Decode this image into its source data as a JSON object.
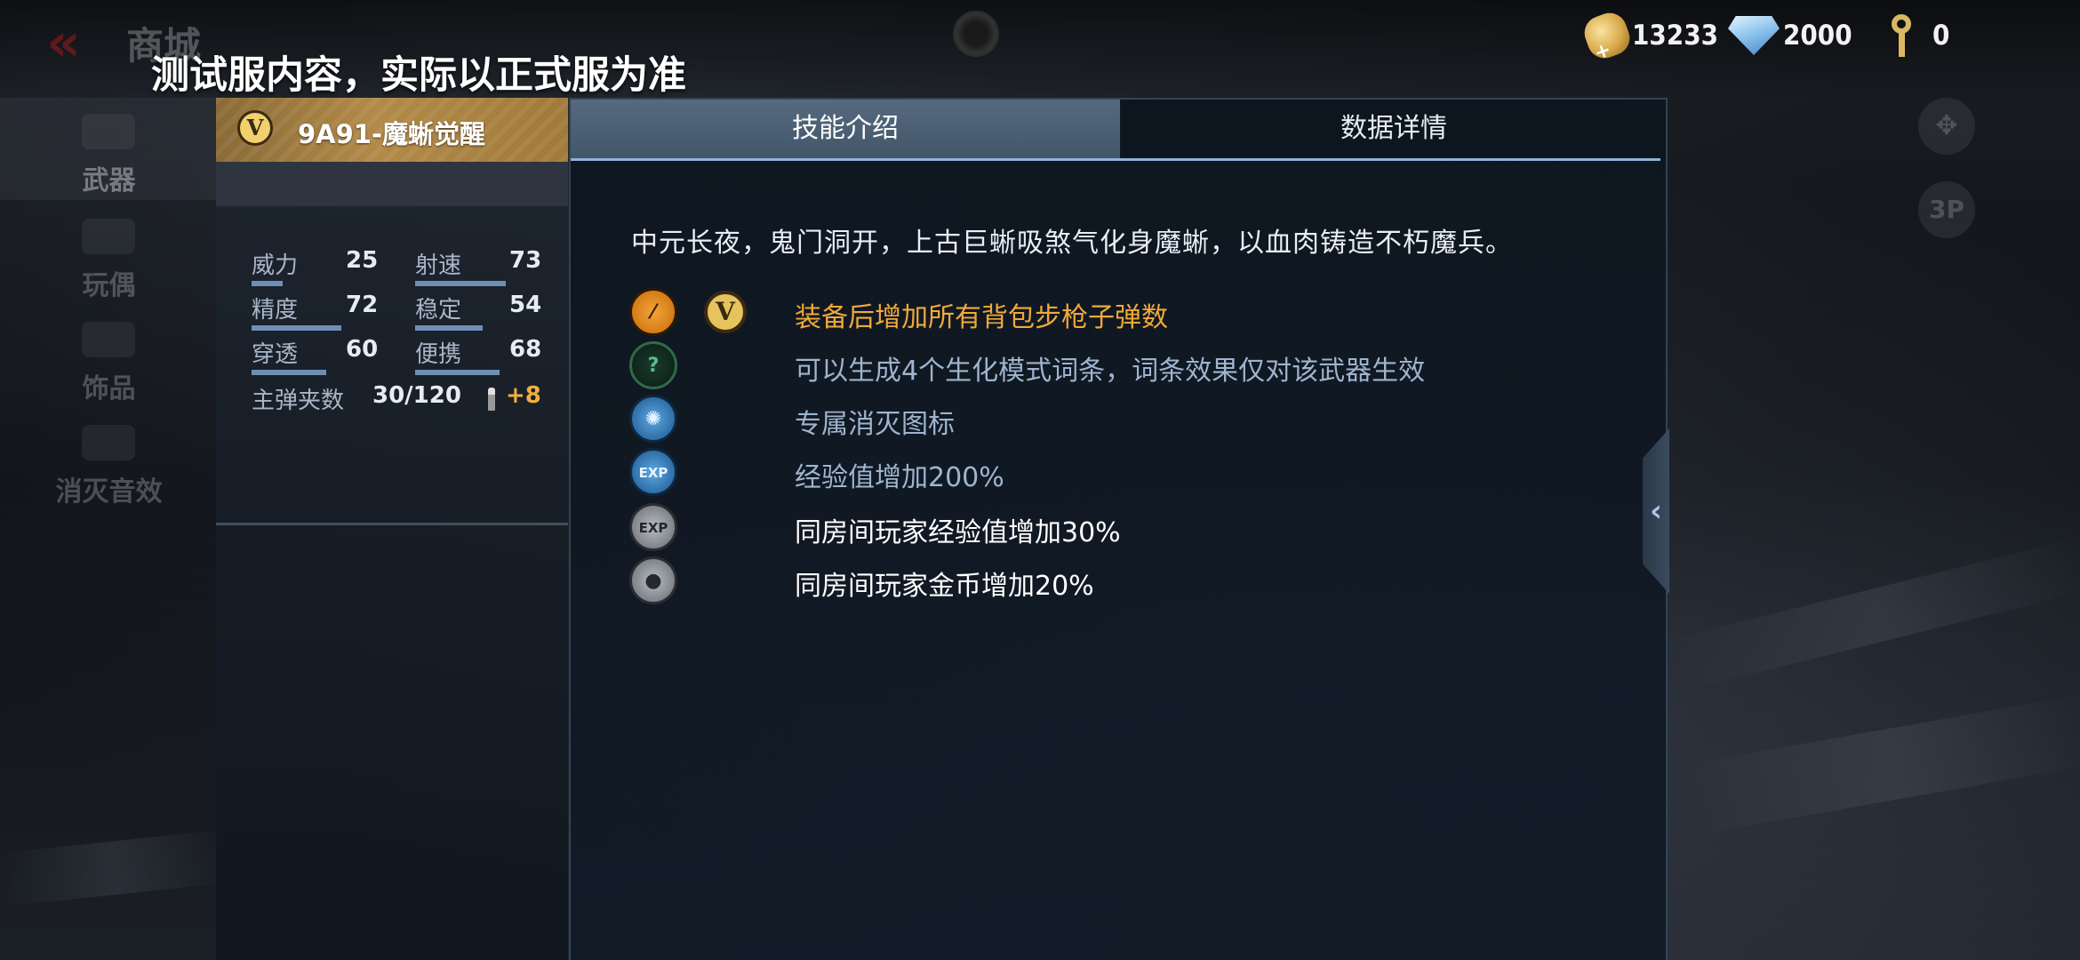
{
  "header": {
    "shop_title": "商城",
    "notice": "测试服内容，实际以正式服为准",
    "currencies": [
      {
        "name": "gold-coin-icon",
        "value": "13233",
        "color": "#d9a94a"
      },
      {
        "name": "diamond-icon",
        "value": "2000",
        "color": "#8fc4ee"
      },
      {
        "name": "key-icon",
        "value": "0",
        "color": "#d8b862"
      }
    ]
  },
  "sidebar": {
    "items": [
      {
        "label": "武器",
        "active": true
      },
      {
        "label": "玩偶",
        "active": false
      },
      {
        "label": "饰品",
        "active": false
      },
      {
        "label": "消灭音效",
        "active": false
      }
    ]
  },
  "weapon": {
    "rank_badge": "V",
    "name": "9A91-魔蜥觉醒",
    "stats": [
      {
        "key": "威力",
        "value": "25",
        "level": 25
      },
      {
        "key": "射速",
        "value": "73",
        "level": 73
      },
      {
        "key": "精度",
        "value": "72",
        "level": 72
      },
      {
        "key": "稳定",
        "value": "54",
        "level": 54
      },
      {
        "key": "穿透",
        "value": "60",
        "level": 60
      },
      {
        "key": "便携",
        "value": "68",
        "level": 68
      }
    ],
    "magazine_label": "主弹夹数",
    "magazine_value": "30/120",
    "magazine_bonus": "+8"
  },
  "tabs": {
    "skill": "技能介绍",
    "data": "数据详情"
  },
  "skills": {
    "description": "中元长夜，鬼门洞开，上古巨蜥吸煞气化身魔蜥，以血肉铸造不朽魔兵。",
    "badge": "V",
    "items": [
      {
        "icon": "rifle-ammo-icon",
        "text": "装备后增加所有背包步枪子弹数",
        "color": "#f0a93a"
      },
      {
        "icon": "bio-mode-icon",
        "text": "可以生成4个生化模式词条，词条效果仅对该武器生效",
        "color": "#9fb4ce"
      },
      {
        "icon": "elimination-icon",
        "text": "专属消灭图标",
        "color": "#9fb4ce"
      },
      {
        "icon": "exp-boost-icon",
        "text": "经验值增加200%",
        "color": "#9fb4ce"
      },
      {
        "icon": "room-exp-icon",
        "text": "同房间玩家经验值增加30%",
        "color": "#ffffff"
      },
      {
        "icon": "room-coin-icon",
        "text": "同房间玩家金币增加20%",
        "color": "#ffffff"
      }
    ]
  },
  "right_controls": {
    "camera_label": "3P"
  }
}
